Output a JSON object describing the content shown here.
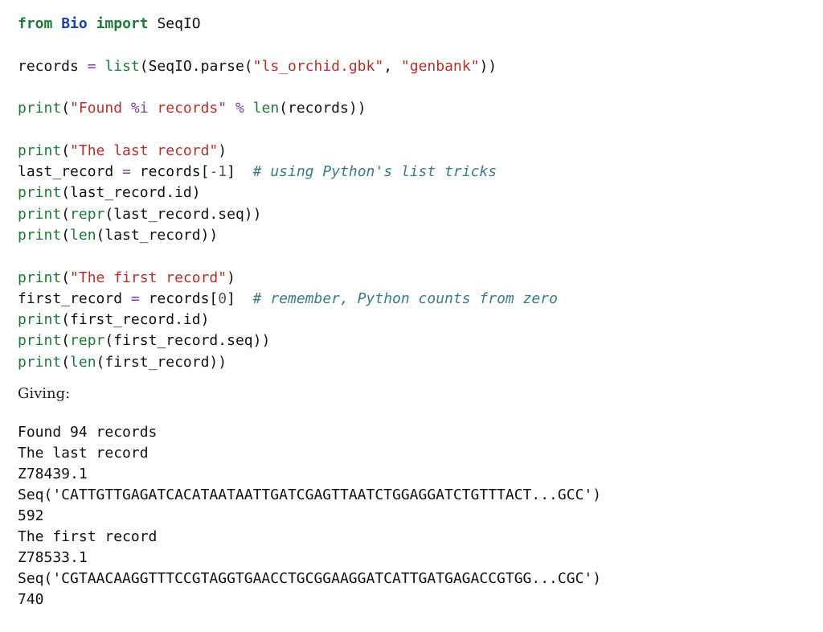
{
  "code": {
    "l1": {
      "kw_from": "from",
      "mod": "Bio",
      "kw_import": "import",
      "name": "SeqIO"
    },
    "l3": {
      "lhs": "records",
      "eq": "=",
      "fn_list": "list",
      "call": "(SeqIO.parse(",
      "s1": "\"ls_orchid.gbk\"",
      "comma": ", ",
      "s2": "\"genbank\"",
      "close": "))"
    },
    "l5": {
      "fn_print": "print",
      "open": "(",
      "s1": "\"Found ",
      "fmt": "%i",
      "s2": " records\"",
      "pct": " % ",
      "fn_len": "len",
      "rest": "(records))"
    },
    "l7": {
      "fn_print": "print",
      "open": "(",
      "s": "\"The last record\"",
      "close": ")"
    },
    "l8": {
      "lhs": "last_record",
      "eq": " = ",
      "rhs": "records[",
      "idx": "-1",
      "close": "]",
      "cmt": "# using Python's list tricks"
    },
    "l9": {
      "fn_print": "print",
      "rest": "(last_record.id)"
    },
    "l10": {
      "fn_print": "print",
      "open": "(",
      "fn_repr": "repr",
      "rest": "(last_record.seq))"
    },
    "l11": {
      "fn_print": "print",
      "open": "(",
      "fn_len": "len",
      "rest": "(last_record))"
    },
    "l13": {
      "fn_print": "print",
      "open": "(",
      "s": "\"The first record\"",
      "close": ")"
    },
    "l14": {
      "lhs": "first_record",
      "eq": " = ",
      "rhs": "records[",
      "idx": "0",
      "close": "]",
      "cmt": "# remember, Python counts from zero"
    },
    "l15": {
      "fn_print": "print",
      "rest": "(first_record.id)"
    },
    "l16": {
      "fn_print": "print",
      "open": "(",
      "fn_repr": "repr",
      "rest": "(first_record.seq))"
    },
    "l17": {
      "fn_print": "print",
      "open": "(",
      "fn_len": "len",
      "rest": "(first_record))"
    }
  },
  "prose": {
    "giving": "Giving:"
  },
  "output": [
    "Found 94 records",
    "The last record",
    "Z78439.1",
    "Seq('CATTGTTGAGATCACATAATAATTGATCGAGTTAATCTGGAGGATCTGTTTACT...GCC')",
    "592",
    "The first record",
    "Z78533.1",
    "Seq('CGTAACAAGGTTTCCGTAGGTGAACCTGCGGAAGGATCATTGATGAGACCGTGG...CGC')",
    "740"
  ]
}
